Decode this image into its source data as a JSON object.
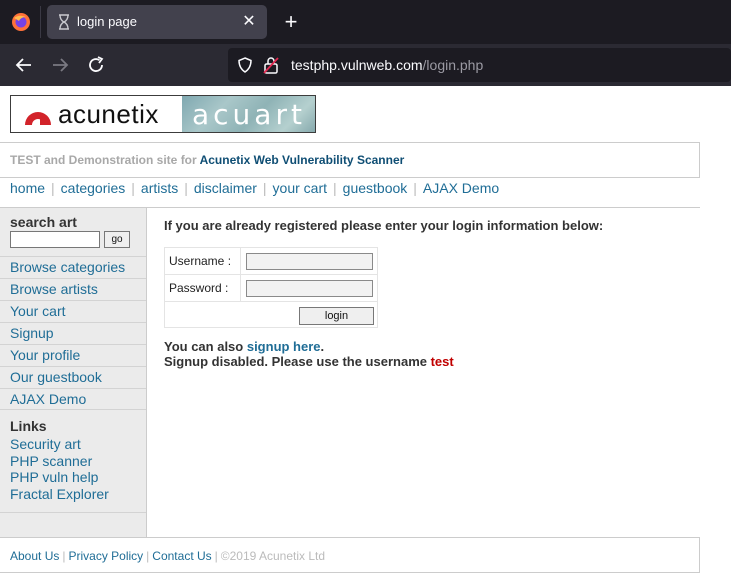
{
  "browser": {
    "tab_title": "login page",
    "url_host": "testphp.vulnweb.com",
    "url_path": "/login.php"
  },
  "logo": {
    "left_text": "acunetix",
    "right_text": "acuart"
  },
  "tagline": {
    "prefix": "TEST and Demonstration site for ",
    "link": "Acunetix Web Vulnerability Scanner"
  },
  "topnav": [
    "home",
    "categories",
    "artists",
    "disclaimer",
    "your cart",
    "guestbook",
    "AJAX Demo"
  ],
  "sidebar": {
    "search_heading": "search art",
    "go_label": "go",
    "items": [
      "Browse categories",
      "Browse artists",
      "Your cart",
      "Signup",
      "Your profile",
      "Our guestbook",
      "AJAX Demo"
    ],
    "links_heading": "Links",
    "links": [
      "Security art",
      "PHP scanner",
      "PHP vuln help",
      "Fractal Explorer"
    ]
  },
  "main": {
    "intro": "If you are already registered please enter your login information below:",
    "username_label": "Username :",
    "password_label": "Password :",
    "login_button": "login",
    "also_text": "You can also ",
    "signup_link": "signup here",
    "also_suffix": ".",
    "disabled_text": "Signup disabled. Please use the username ",
    "username_hint": "test"
  },
  "footer": {
    "links": [
      "About Us",
      "Privacy Policy",
      "Contact Us"
    ],
    "copyright": "©2019 Acunetix Ltd"
  },
  "colors": {
    "link": "#1f6d96",
    "hint": "#c00000",
    "chrome_dark": "#1c1b22"
  }
}
